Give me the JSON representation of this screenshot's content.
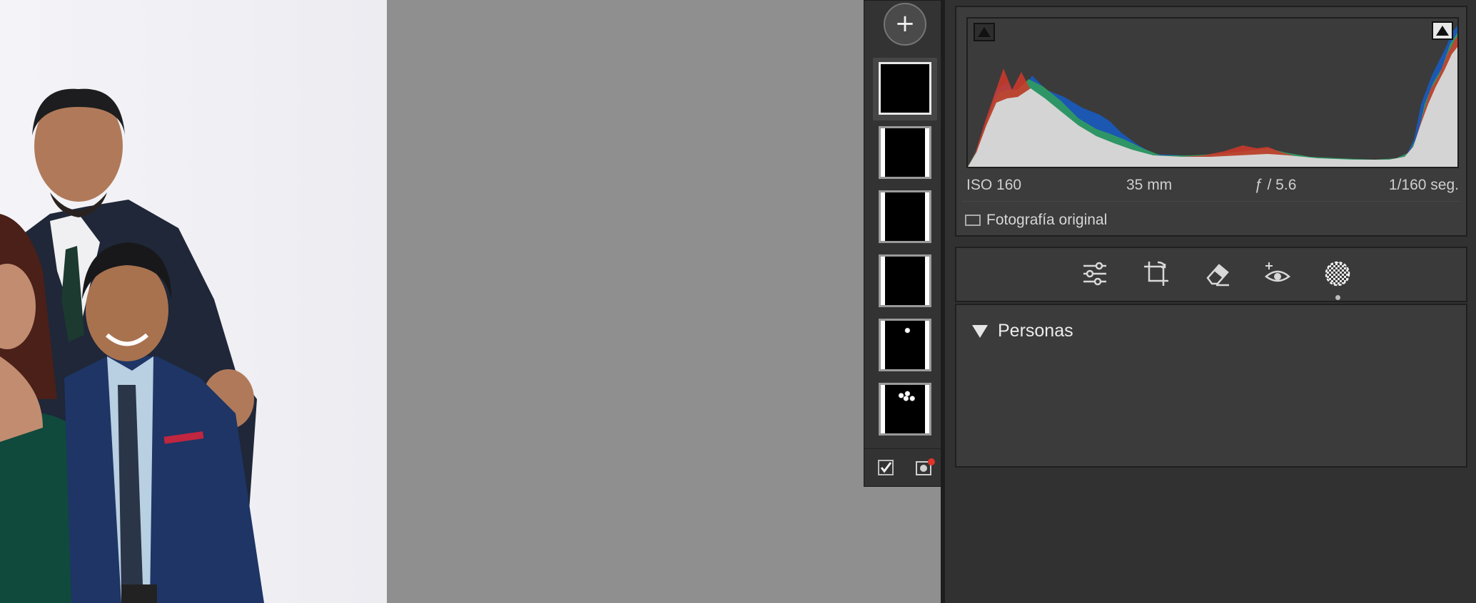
{
  "canvas": {
    "background": "#8f8f8f"
  },
  "mask_strip": {
    "add_label": "+",
    "thumbnails": [
      {
        "name": "mask-thumb-1",
        "selected": true
      },
      {
        "name": "mask-thumb-2",
        "selected": false
      },
      {
        "name": "mask-thumb-3",
        "selected": false
      },
      {
        "name": "mask-thumb-4",
        "selected": false
      },
      {
        "name": "mask-thumb-5",
        "selected": false
      },
      {
        "name": "mask-thumb-6",
        "selected": false
      }
    ],
    "footer_icons": [
      "checkbox-icon",
      "mask-overlay-icon"
    ]
  },
  "histogram": {
    "iso": "ISO 160",
    "focal_length": "35 mm",
    "aperture": "ƒ / 5.6",
    "shutter": "1/160 seg.",
    "original_photo_label": "Fotografía original"
  },
  "tools": {
    "items": [
      "edit-sliders-icon",
      "crop-icon",
      "eraser-icon",
      "red-eye-icon",
      "masking-icon"
    ],
    "active": "masking-icon"
  },
  "masks_panel": {
    "section_title": "Personas"
  }
}
